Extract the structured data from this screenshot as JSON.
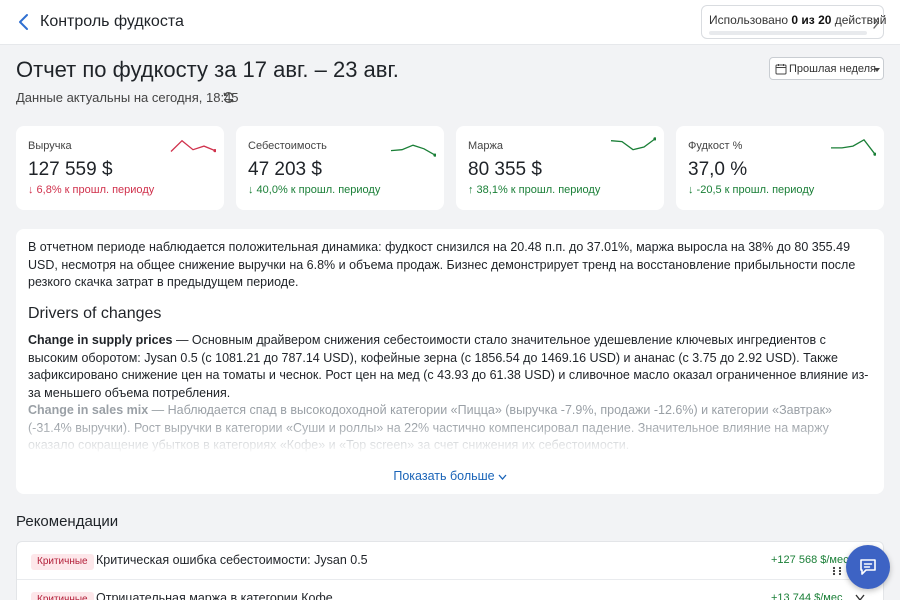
{
  "header": {
    "title": "Контроль фудкоста",
    "usage_prefix": "Использовано ",
    "usage_count": "0 из 20",
    "usage_suffix": " действий"
  },
  "report": {
    "title": "Отчет по фудкосту за 17 авг. – 23 авг.",
    "updated": "Данные актуальны на сегодня, 18:45",
    "period": "Прошлая неделя"
  },
  "kpis": [
    {
      "label": "Выручка",
      "value": "127 559 $",
      "delta": "↓ 6,8% к прошл. периоду",
      "trend": "negative",
      "spark": [
        0.25,
        0.85,
        0.35,
        0.55,
        0.3
      ]
    },
    {
      "label": "Себестоимость",
      "value": "47 203 $",
      "delta": "↓ 40,0% к прошл. периоду",
      "trend": "positive",
      "spark": [
        0.3,
        0.35,
        0.6,
        0.4,
        0.05
      ]
    },
    {
      "label": "Маржа",
      "value": "80 355 $",
      "delta": "↑ 38,1% к прошл. периоду",
      "trend": "positive",
      "spark": [
        0.85,
        0.8,
        0.35,
        0.5,
        0.95
      ]
    },
    {
      "label": "Фудкост %",
      "value": "37,0 %",
      "delta": "↓ -20,5 к прошл. периоду",
      "trend": "positive",
      "spark": [
        0.45,
        0.45,
        0.55,
        0.9,
        0.1
      ]
    }
  ],
  "summary": {
    "text": "В отчетном периоде наблюдается положительная динамика: фудкост снизился на 20.48 п.п. до 37.01%, маржа выросла на 38% до 80 355.49 USD, несмотря на общее снижение выручки на 6.8% и объема продаж. Бизнес демонстрирует тренд на восстановление прибыльности после резкого скачка затрат в предыдущем периоде.",
    "drivers_title": "Drivers of changes",
    "drivers": [
      {
        "head": "Change in supply prices",
        "body": " — Основным драйвером снижения себестоимости стало значительное удешевление ключевых ингредиентов с высоким оборотом: Jysan 0.5 (с 1081.21 до 787.14 USD), кофейные зерна (с 1856.54 до 1469.16 USD) и ананас (с 3.75 до 2.92 USD). Также зафиксировано снижение цен на томаты и чеснок. Рост цен на мед (с 43.93 до 61.38 USD) и сливочное масло оказал ограниченное влияние из-за меньшего объема потребления."
      },
      {
        "head": "Change in sales mix",
        "body": " — Наблюдается спад в высокодоходной категории «Пицца» (выручка -7.9%, продажи -12.6%) и категории «Завтрак» (-31.4% выручки). Рост выручки в категории «Суши и роллы» на 22% частично компенсировал падение. Значительное влияние на маржу оказало сокращение убытков в категориях «Кофе» и «Top screen» за счет снижения их себестоимости."
      }
    ],
    "show_more": "Показать больше"
  },
  "recommendations": {
    "title": "Рекомендации",
    "items": [
      {
        "badge": "Критичные",
        "text": "Критическая ошибка себестоимости: Jysan 0.5",
        "amount": "+127 568 $/мес"
      },
      {
        "badge": "Критичные",
        "text": "Отрицательная маржа в категории Кофе",
        "amount": "+13 744 $/мес"
      }
    ]
  },
  "colors": {
    "negative": "#d0314c",
    "positive": "#1a7f37",
    "link": "#1a64b8",
    "chat_button": "#3d63c4"
  }
}
